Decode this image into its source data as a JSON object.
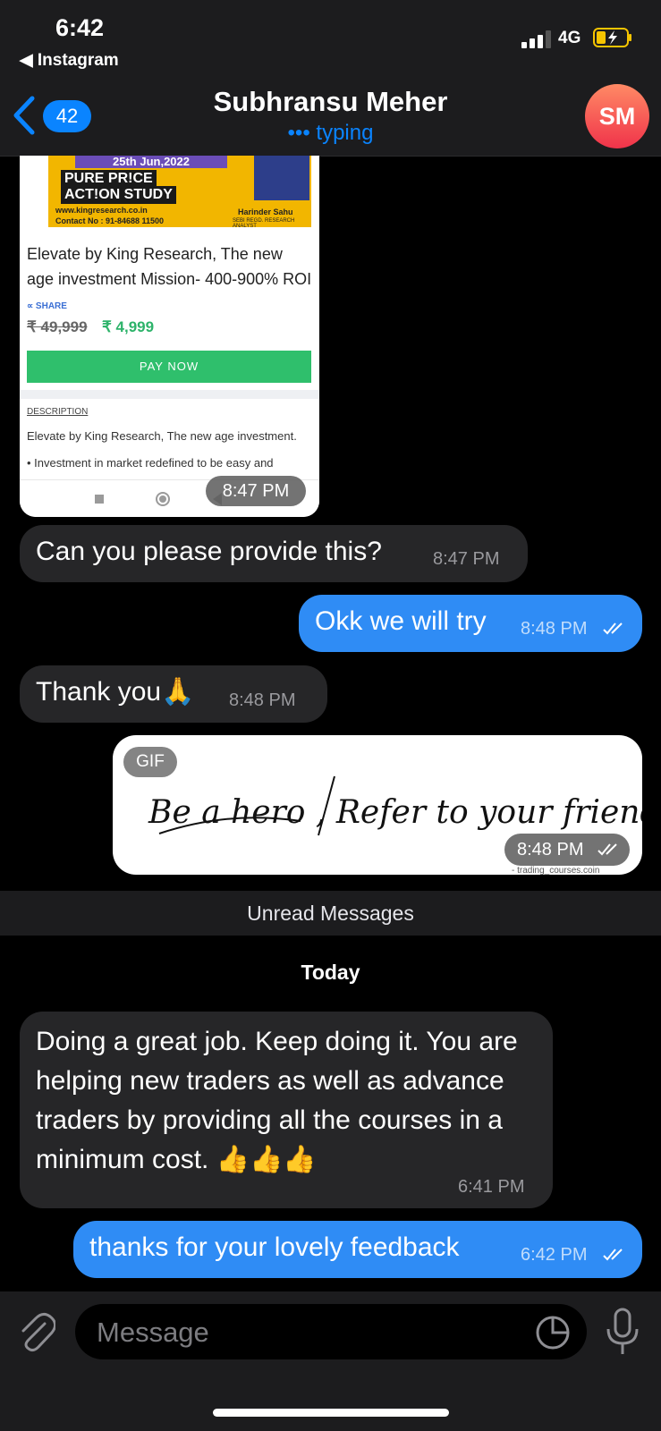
{
  "status_bar": {
    "time": "6:42",
    "back_app": "◀ Instagram",
    "network": "4G"
  },
  "header": {
    "back_count": "42",
    "contact_name": "Subhransu Meher",
    "status": "••• typing",
    "avatar_initials": "SM"
  },
  "shared_screenshot": {
    "banner_date": "25th Jun,2022",
    "banner_line1": "PURE PR!CE",
    "banner_line2": "ACT!ON STUDY",
    "banner_site": "www.kingresearch.co.in",
    "banner_contact": "Contact No : 91-84688 11500",
    "banner_person": "Harinder Sahu",
    "banner_person_title": "SEBI REGD. RESEARCH ANALYST",
    "product_title": "Elevate by King Research, The new age investment Mission- 400-900% ROI",
    "share_label": "SHARE",
    "price_old": "₹ 49,999",
    "price_new": "₹ 4,999",
    "pay_button": "PAY NOW",
    "description_label": "DESCRIPTION",
    "description_text": "Elevate by King Research, The new age investment.",
    "description_bullet": "• Investment in market redefined to be easy and",
    "time": "8:47 PM"
  },
  "messages": [
    {
      "direction": "incoming",
      "text": "Can you please provide this?",
      "time": "8:47 PM"
    },
    {
      "direction": "outgoing",
      "text": "Okk we will try",
      "time": "8:48 PM"
    },
    {
      "direction": "incoming",
      "text": "Thank you🙏",
      "time": "8:48 PM"
    },
    {
      "direction": "outgoing",
      "type": "gif",
      "gif_tag": "GIF",
      "gif_text": "Be a hero , Refer to your friends",
      "credit": "- trading_courses.coin",
      "time": "8:48 PM"
    },
    {
      "direction": "incoming",
      "text": "Doing a great job. Keep doing it. You are helping new traders as well as advance traders by providing all the courses in a minimum cost. 👍👍👍",
      "time": "6:41 PM"
    },
    {
      "direction": "outgoing",
      "text": "thanks for your lovely feedback",
      "time": "6:42 PM"
    }
  ],
  "separators": {
    "unread": "Unread Messages",
    "today": "Today"
  },
  "input": {
    "placeholder": "Message"
  },
  "colors": {
    "accent": "#0a84ff",
    "outgoing_bubble": "#2f8cf5",
    "incoming_bubble": "#262628",
    "background": "#000000"
  },
  "icons": [
    "back-chevron-icon",
    "signal-icon",
    "battery-icon",
    "double-check-icon",
    "attach-icon",
    "sticker-icon",
    "microphone-icon"
  ]
}
